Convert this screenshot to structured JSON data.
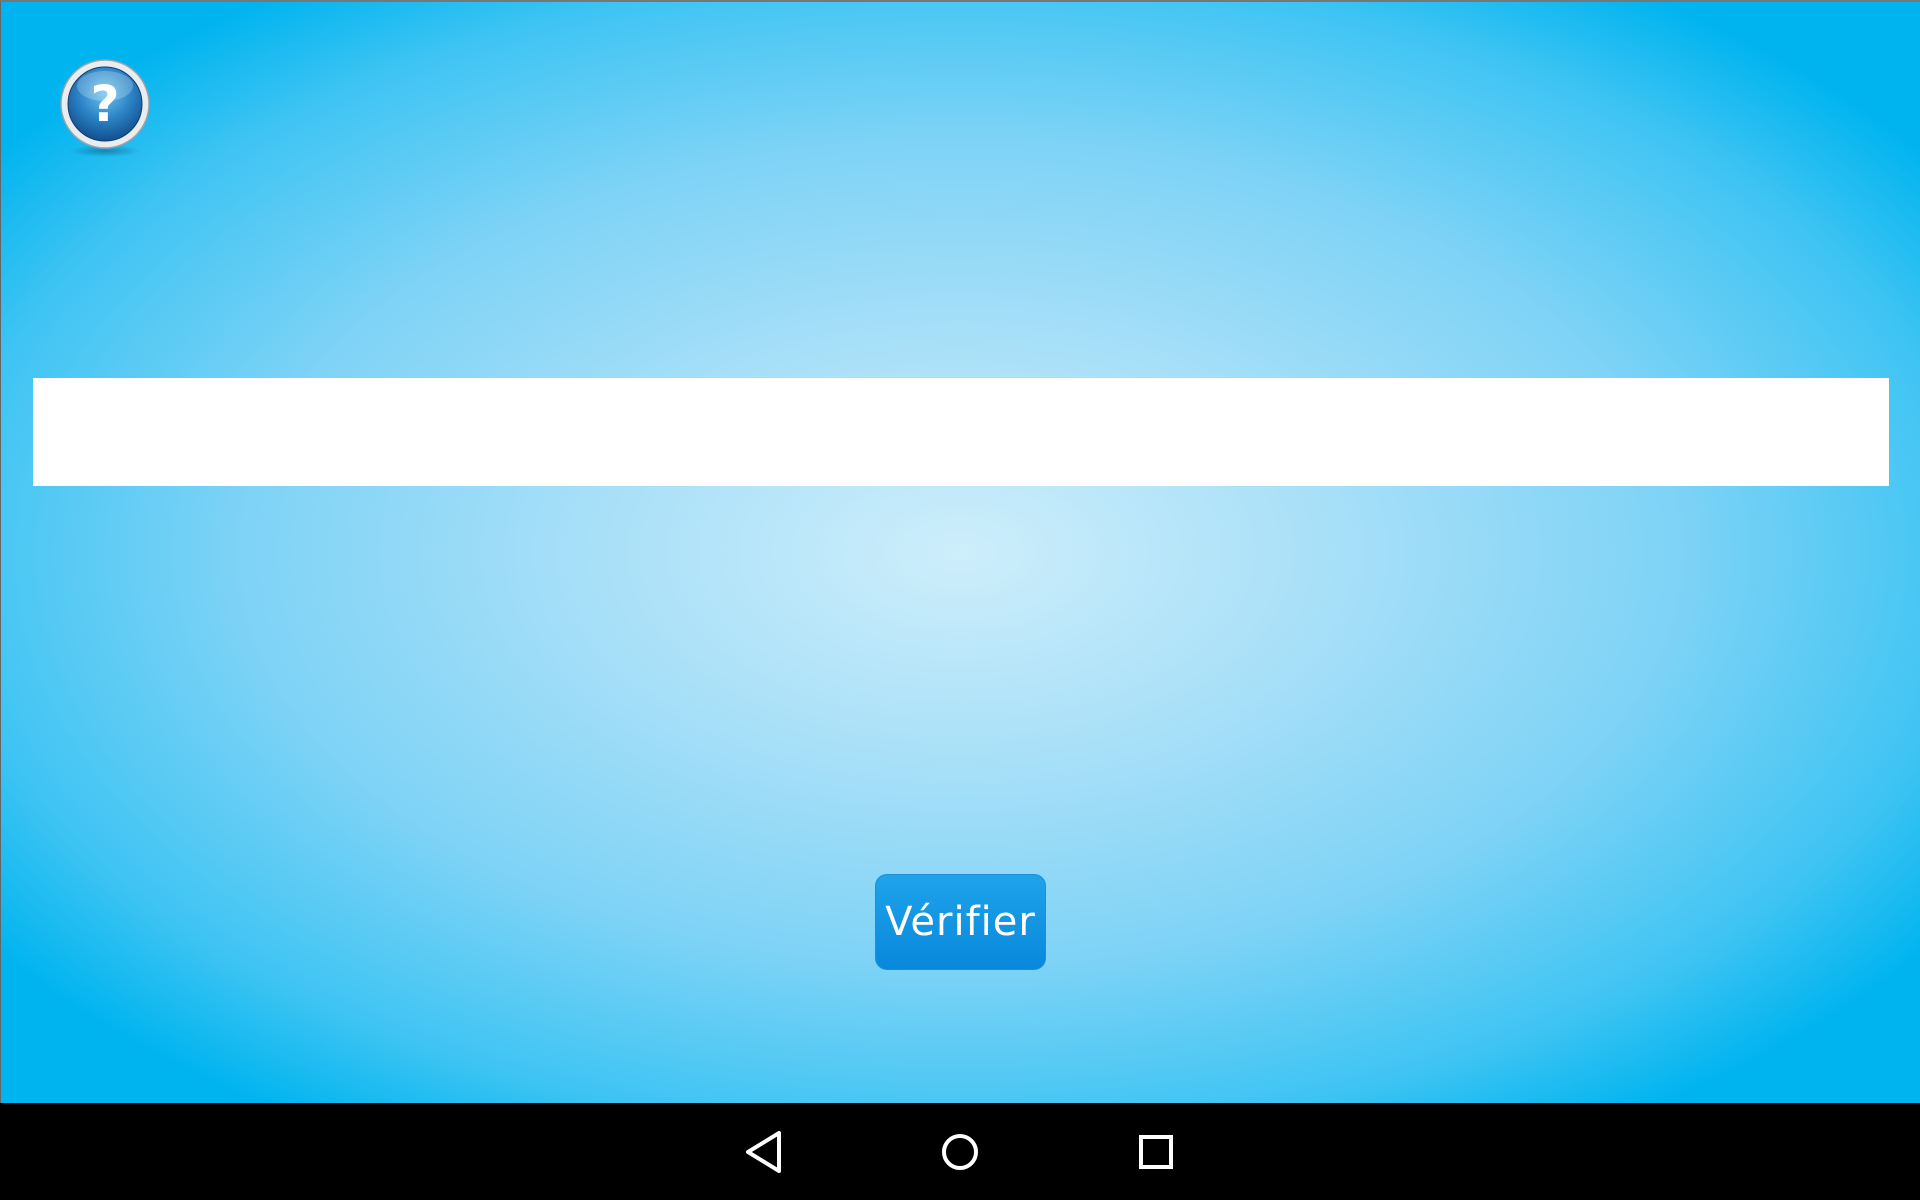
{
  "help": {
    "icon": "question-mark-icon",
    "glyph": "?"
  },
  "answer": {
    "value": "",
    "placeholder": ""
  },
  "verify": {
    "label": "Vérifier"
  },
  "navbar": {
    "back_icon": "back-triangle-icon",
    "home_icon": "home-circle-icon",
    "recents_icon": "recents-square-icon"
  },
  "colors": {
    "background_center": "#cdeefb",
    "background_edge": "#00b4ef",
    "button": "#0e90e0",
    "navbar": "#000000"
  }
}
